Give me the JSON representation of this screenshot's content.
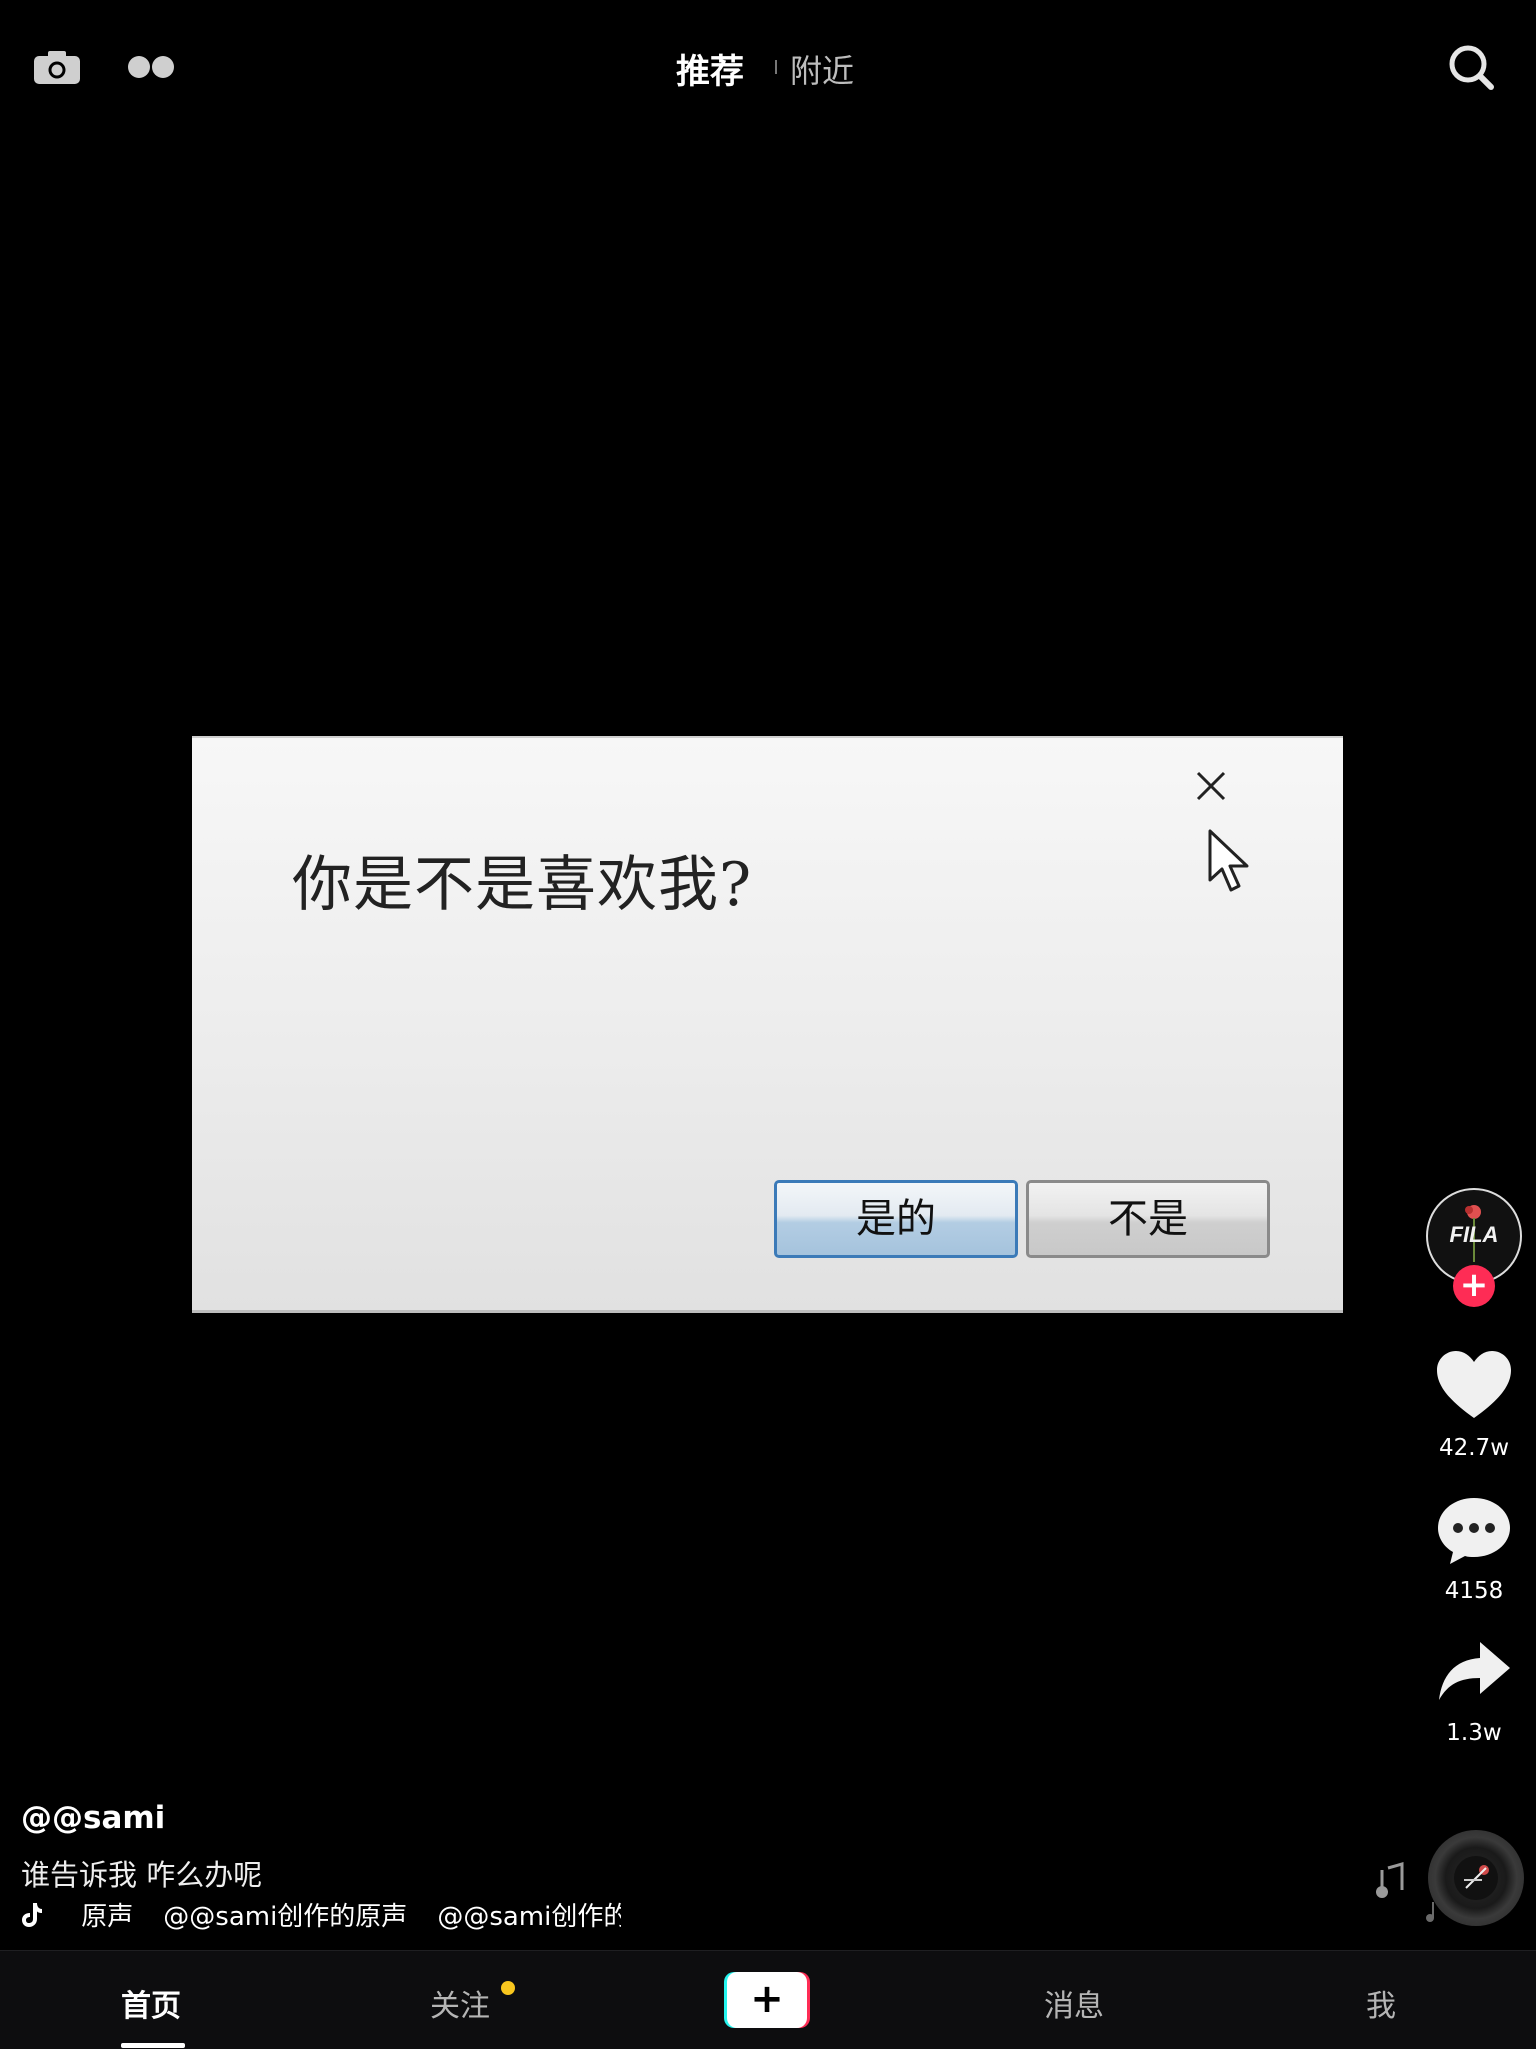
{
  "header": {
    "tabs": [
      {
        "label": "推荐",
        "active": true
      },
      {
        "label": "附近",
        "active": false
      }
    ],
    "icons": [
      "camera-icon",
      "dual-dot-icon",
      "search-icon"
    ]
  },
  "video": {
    "dialog": {
      "question": "你是不是喜欢我?",
      "yes_label": "是的",
      "no_label": "不是"
    }
  },
  "actions": {
    "avatar_text": "FILA",
    "likes": "42.7w",
    "comments": "4158",
    "shares": "1.3w"
  },
  "caption": {
    "author": "@@sami",
    "description": "谁告诉我 咋么办呢",
    "music": [
      "原声",
      "@@sami创作的原声",
      "@@sami创作的"
    ]
  },
  "nav": {
    "home": "首页",
    "follow": "关注",
    "create": "+",
    "messages": "消息",
    "me": "我"
  },
  "colors": {
    "accent_red": "#fe2c55",
    "accent_cyan": "#25f4ee",
    "notify_dot": "#f8c61e",
    "dialog_yes_border": "#3b7ab8"
  }
}
